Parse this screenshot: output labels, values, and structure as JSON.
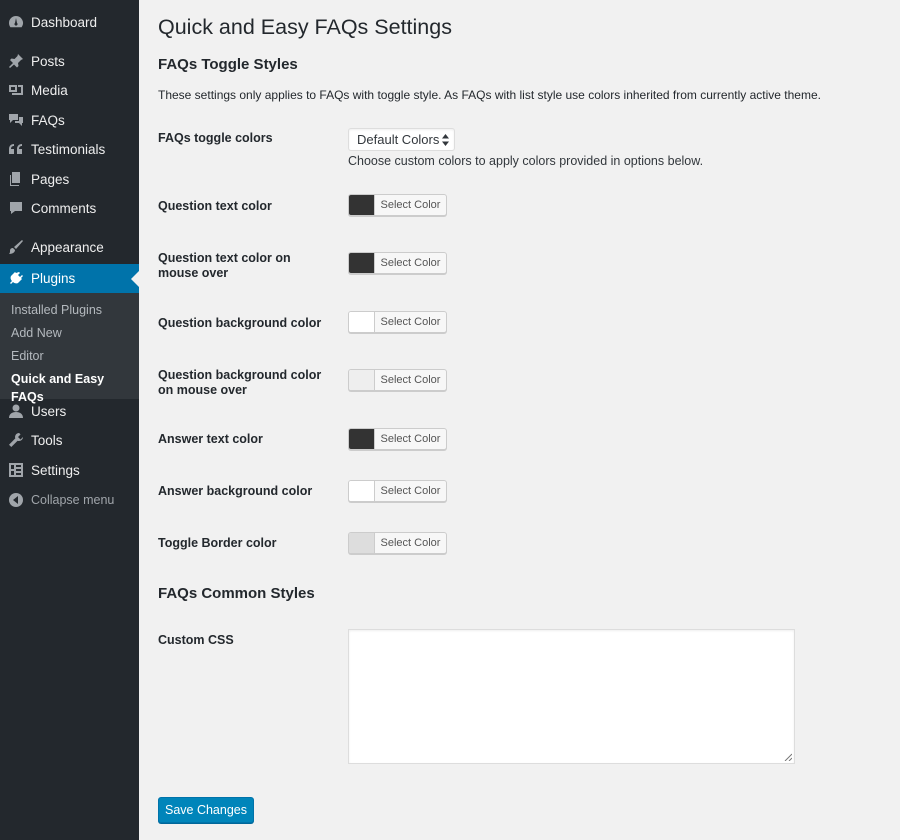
{
  "sidebar": {
    "items": [
      {
        "label": "Dashboard",
        "icon": "dashboard-icon"
      },
      {
        "label": "Posts",
        "icon": "pin-icon"
      },
      {
        "label": "Media",
        "icon": "media-icon"
      },
      {
        "label": "FAQs",
        "icon": "faq-icon"
      },
      {
        "label": "Testimonials",
        "icon": "quote-icon"
      },
      {
        "label": "Pages",
        "icon": "pages-icon"
      },
      {
        "label": "Comments",
        "icon": "comment-icon"
      },
      {
        "label": "Appearance",
        "icon": "brush-icon"
      },
      {
        "label": "Plugins",
        "icon": "plugin-icon"
      },
      {
        "label": "Users",
        "icon": "user-icon"
      },
      {
        "label": "Tools",
        "icon": "wrench-icon"
      },
      {
        "label": "Settings",
        "icon": "settings-icon"
      },
      {
        "label": "Collapse menu",
        "icon": "collapse-icon"
      }
    ],
    "submenu": [
      "Installed Plugins",
      "Add New",
      "Editor",
      "Quick and Easy FAQs"
    ]
  },
  "page": {
    "title": "Quick and Easy FAQs Settings",
    "toggle_section_title": "FAQs Toggle Styles",
    "toggle_section_desc": "These settings only applies to FAQs with toggle style. As FAQs with list style use colors inherited from currently active theme.",
    "toggle_colors_label": "FAQs toggle colors",
    "toggle_colors_value": "Default Colors",
    "toggle_colors_help": "Choose custom colors to apply colors provided in options below.",
    "color_fields": [
      {
        "label": "Question text color",
        "swatch": "#333333",
        "button": "Select Color"
      },
      {
        "label": "Question text color on mouse over",
        "swatch": "#333333",
        "button": "Select Color"
      },
      {
        "label": "Question background color",
        "swatch": "#ffffff",
        "button": "Select Color"
      },
      {
        "label": "Question background color on mouse over",
        "swatch": "#eeeeee",
        "button": "Select Color"
      },
      {
        "label": "Answer text color",
        "swatch": "#333333",
        "button": "Select Color"
      },
      {
        "label": "Answer background color",
        "swatch": "#ffffff",
        "button": "Select Color"
      },
      {
        "label": "Toggle Border color",
        "swatch": "#dddddd",
        "button": "Select Color"
      }
    ],
    "common_section_title": "FAQs Common Styles",
    "custom_css_label": "Custom CSS",
    "custom_css_value": "",
    "save_label": "Save Changes"
  },
  "colors": {
    "sidebar_bg": "#23282d",
    "submenu_bg": "#32373c",
    "accent": "#0073aa",
    "button_primary": "#0085ba"
  }
}
